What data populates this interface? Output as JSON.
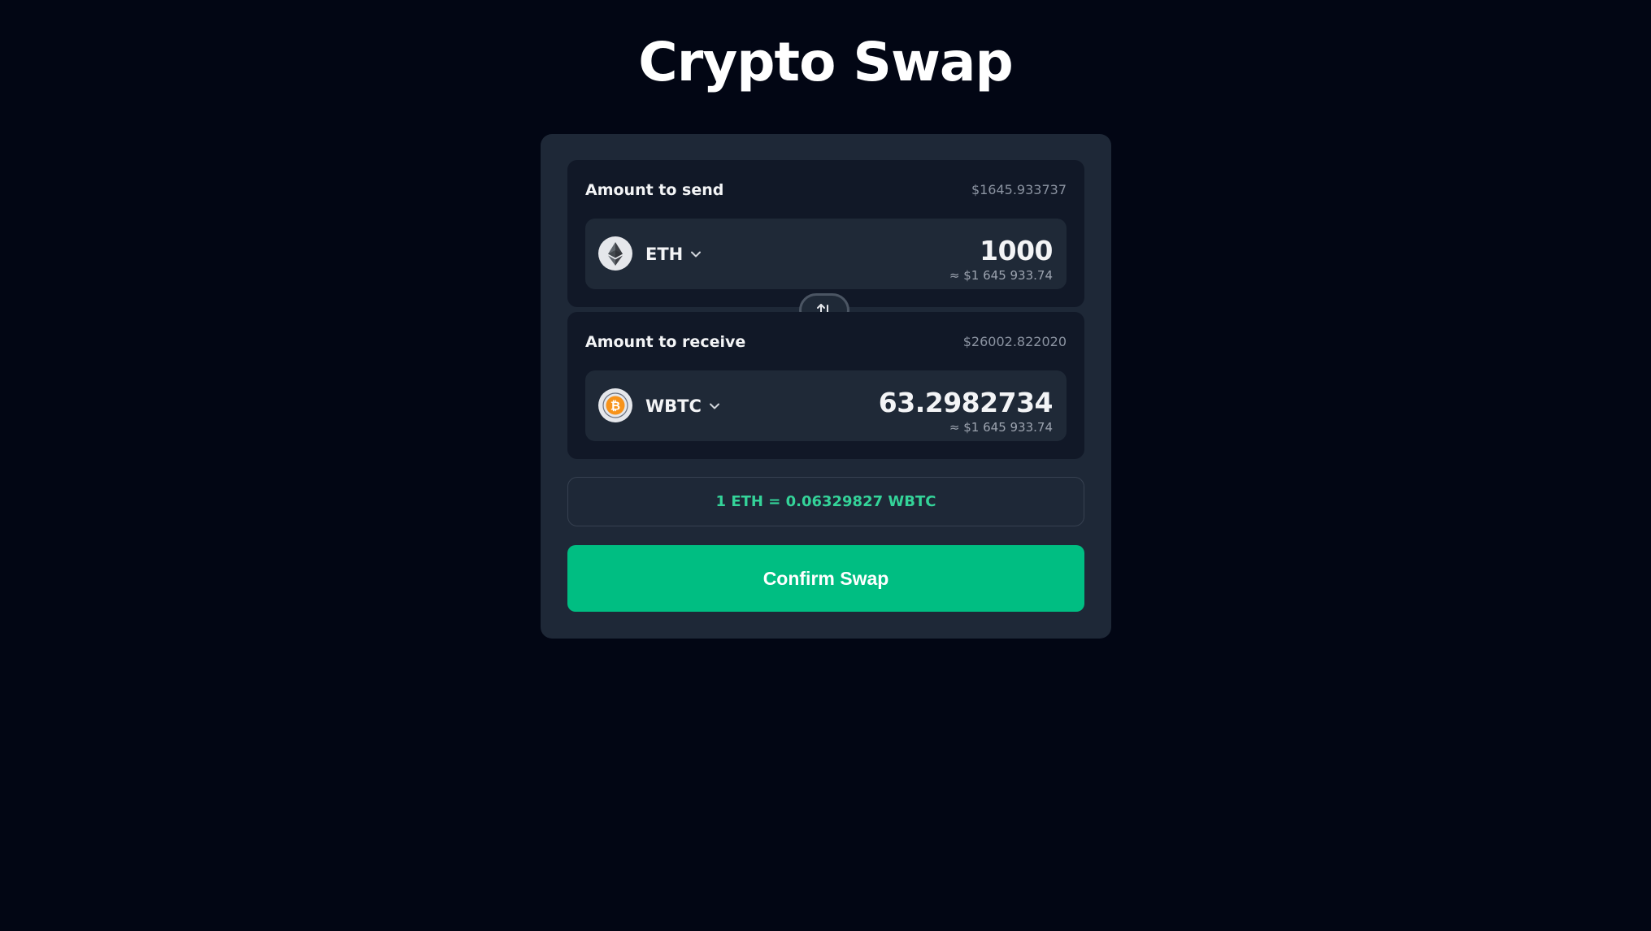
{
  "header": {
    "title": "Crypto Swap"
  },
  "send": {
    "label": "Amount to send",
    "balance_usd": "$1645.933737",
    "token": {
      "symbol": "ETH",
      "icon": "ethereum-icon"
    },
    "amount": "1000",
    "amount_usd": "≈ $1 645 933.74"
  },
  "swap": {
    "icon": "swap-arrows-icon"
  },
  "receive": {
    "label": "Amount to receive",
    "balance_usd": "$26002.822020",
    "token": {
      "symbol": "WBTC",
      "icon": "bitcoin-icon"
    },
    "amount": "63.2982734",
    "amount_usd": "≈ $1 645 933.74"
  },
  "rate": {
    "text": "1 ETH = 0.06329827 WBTC"
  },
  "actions": {
    "confirm_label": "Confirm Swap"
  },
  "colors": {
    "background": "#020614",
    "card": "#1e2837",
    "accent": "#00be82",
    "rate_text": "#34d399",
    "bitcoin": "#f7931a"
  }
}
